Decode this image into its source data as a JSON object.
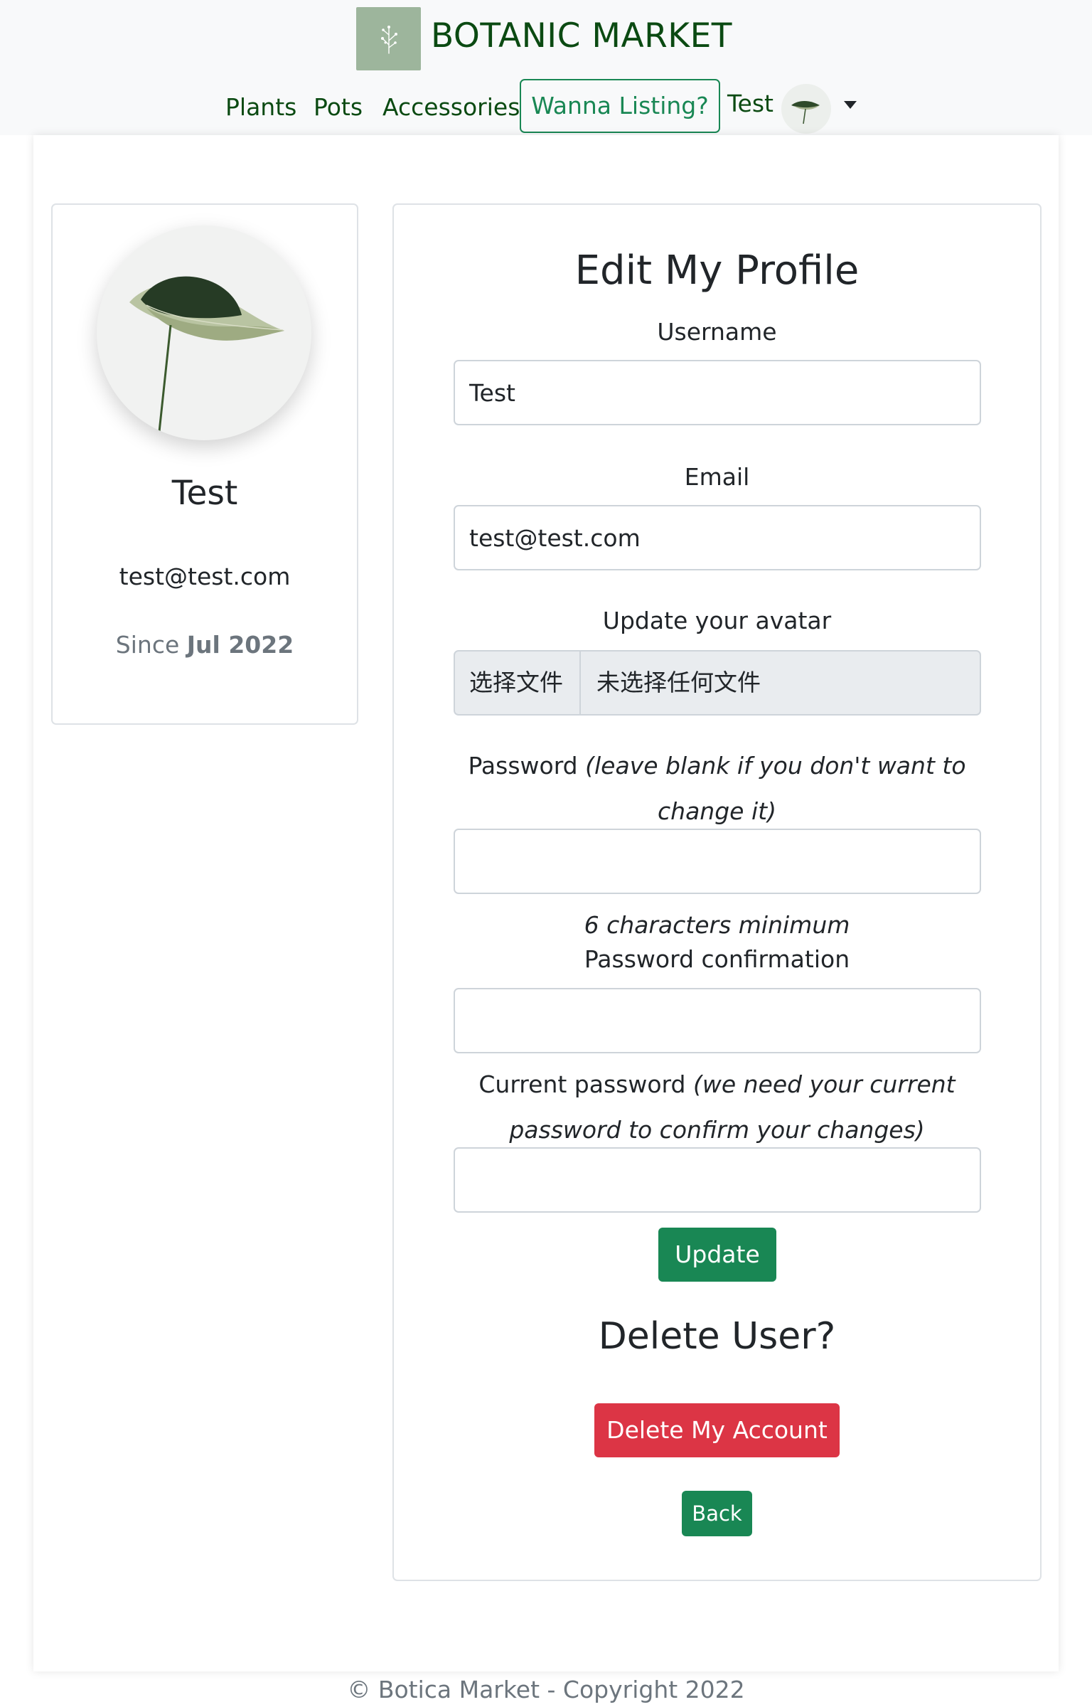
{
  "brand": {
    "title": "BOTANIC MARKET"
  },
  "nav": {
    "plants": "Plants",
    "pots": "Pots",
    "accessories": "Accessories",
    "listing_cta": "Wanna Listing?",
    "username": "Test"
  },
  "profile": {
    "name": "Test",
    "email": "test@test.com",
    "since_prefix": "Since ",
    "since_date": "Jul 2022"
  },
  "form": {
    "title": "Edit My Profile",
    "username_label": "Username",
    "username_value": "Test",
    "email_label": "Email",
    "email_value": "test@test.com",
    "avatar_label": "Update your avatar",
    "file_button": "选择文件",
    "file_status": "未选择任何文件",
    "password_label": "Password",
    "password_hint_line1": "(leave blank if you don't want to",
    "password_hint_line2": "change it)",
    "password_value": "",
    "password_min_hint": "6 characters minimum",
    "password_confirm_label": "Password confirmation",
    "password_confirm_value": "",
    "current_password_label": "Current password",
    "current_password_hint_line1": "(we need your current",
    "current_password_hint_line2": "password to confirm your changes)",
    "current_password_value": "",
    "update_button": "Update"
  },
  "delete": {
    "title": "Delete User?",
    "button": "Delete My Account"
  },
  "back_button": "Back",
  "footer": {
    "text": "© Botica Market - Copyright 2022"
  },
  "colors": {
    "brand_green": "#0b4a12",
    "primary_green": "#198754",
    "danger_red": "#dc3545",
    "muted_gray": "#6c757d"
  },
  "icons": {
    "brand_logo": "botanical-sprig-icon",
    "user_avatar": "leaf-avatar",
    "dropdown": "caret-down-icon"
  }
}
